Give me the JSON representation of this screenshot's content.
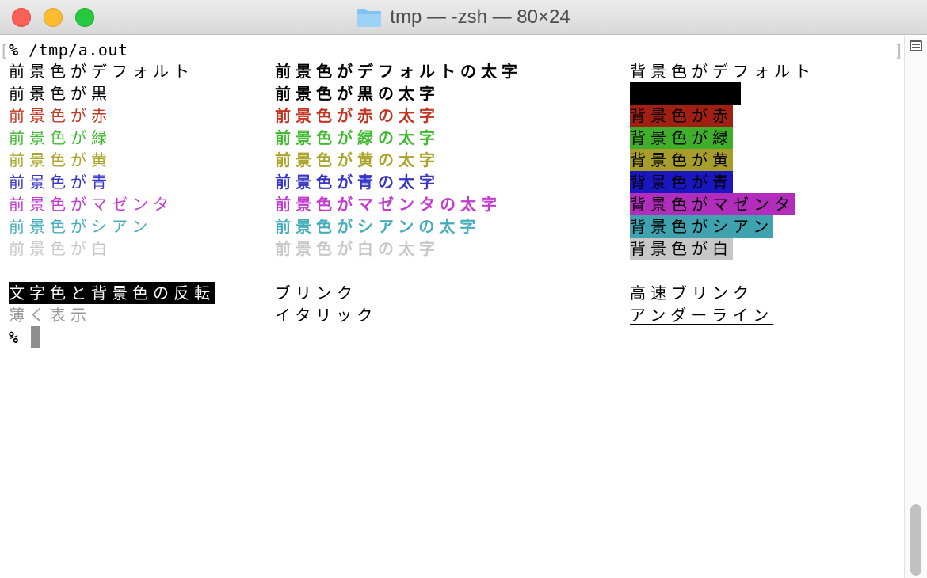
{
  "window": {
    "title": "tmp — -zsh — 80×24",
    "folder_icon": "folder-icon"
  },
  "terminal": {
    "prompt_symbol": "%",
    "command": " /tmp/a.out",
    "rows": [
      {
        "fg": {
          "text": "前景色がデフォルト",
          "color": "#000000"
        },
        "bold": {
          "text": "前景色がデフォルトの太字",
          "color": "#000000"
        },
        "bg": {
          "text": "背景色がデフォルト",
          "color": "#000000",
          "bg": "transparent"
        }
      },
      {
        "fg": {
          "text": "前景色が黒",
          "color": "#000000"
        },
        "bold": {
          "text": "前景色が黒の太字",
          "color": "#000000"
        },
        "bg": {
          "text": "",
          "color": "#000000",
          "bg": "#000000"
        }
      },
      {
        "fg": {
          "text": "前景色が赤",
          "color": "#c23621"
        },
        "bold": {
          "text": "前景色が赤の太字",
          "color": "#c23621"
        },
        "bg": {
          "text": "背景色が赤",
          "color": "#000000",
          "bg": "#a11f13"
        }
      },
      {
        "fg": {
          "text": "前景色が緑",
          "color": "#3fb92f"
        },
        "bold": {
          "text": "前景色が緑の太字",
          "color": "#3fb92f"
        },
        "bg": {
          "text": "背景色が緑",
          "color": "#000000",
          "bg": "#3fae2b"
        }
      },
      {
        "fg": {
          "text": "前景色が黄",
          "color": "#aba42a"
        },
        "bold": {
          "text": "前景色が黄の太字",
          "color": "#aba42a"
        },
        "bg": {
          "text": "背景色が黄",
          "color": "#000000",
          "bg": "#a79d2b"
        }
      },
      {
        "fg": {
          "text": "前景色が青",
          "color": "#3836c8"
        },
        "bold": {
          "text": "前景色が青の太字",
          "color": "#3836c8"
        },
        "bg": {
          "text": "背景色が青",
          "color": "#000000",
          "bg": "#1a16c0"
        }
      },
      {
        "fg": {
          "text": "前景色がマゼンタ",
          "color": "#c23ad0"
        },
        "bold": {
          "text": "前景色がマゼンタの太字",
          "color": "#c23ad0"
        },
        "bg": {
          "text": "背景色がマゼンタ",
          "color": "#000000",
          "bg": "#b32dbc"
        }
      },
      {
        "fg": {
          "text": "前景色がシアン",
          "color": "#46aebb"
        },
        "bold": {
          "text": "前景色がシアンの太字",
          "color": "#46aebb"
        },
        "bg": {
          "text": "背景色がシアン",
          "color": "#000000",
          "bg": "#3ea3ae"
        }
      },
      {
        "fg": {
          "text": "前景色が白",
          "color": "#c8c8c8"
        },
        "bold": {
          "text": "前景色が白の太字",
          "color": "#c8c8c8"
        },
        "bg": {
          "text": "背景色が白",
          "color": "#000000",
          "bg": "#c7c7c7"
        }
      }
    ],
    "styles": {
      "reverse": "文字色と背景色の反転",
      "blink": "ブリンク",
      "fast_blink": "高速ブリンク",
      "dim": "薄く表示",
      "italic": "イタリック",
      "underline": "アンダーライン"
    },
    "final_prompt": "%",
    "dim_color": "#9a9a9a",
    "reverse_bg": "#000000",
    "reverse_fg": "#ffffff"
  }
}
